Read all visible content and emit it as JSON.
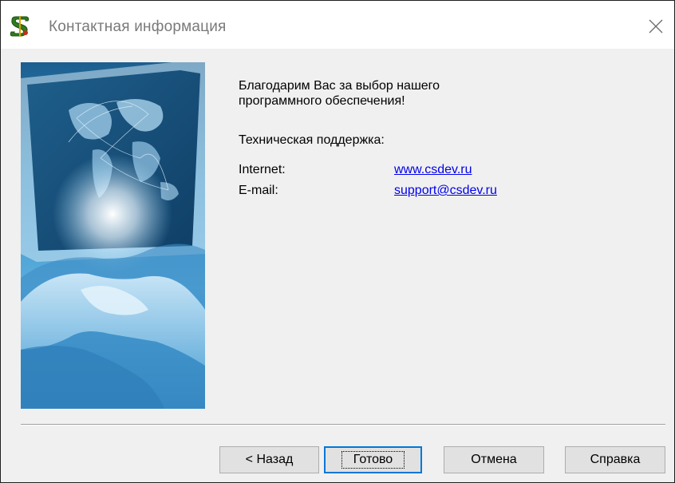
{
  "window": {
    "title": "Контактная информация",
    "app_icon": "green-s-dollar-app-icon",
    "close_icon": "close-icon"
  },
  "content": {
    "thanks_line1": "Благодарим Вас за выбор нашего",
    "thanks_line2": "программного обеспечения!",
    "support_label": "Техническая поддержка:",
    "contacts": [
      {
        "label": "Internet:",
        "value": "www.csdev.ru"
      },
      {
        "label": "E-mail:",
        "value": "support@csdev.ru"
      }
    ]
  },
  "picture": {
    "description_icon": "handshake-world-map-image"
  },
  "buttons": {
    "back": "< Назад",
    "done": "Готово",
    "cancel": "Отмена",
    "help": "Справка"
  },
  "colors": {
    "link": "#0000ee",
    "default_button_border": "#0078d7",
    "dialog_background": "#f0f0f0"
  }
}
